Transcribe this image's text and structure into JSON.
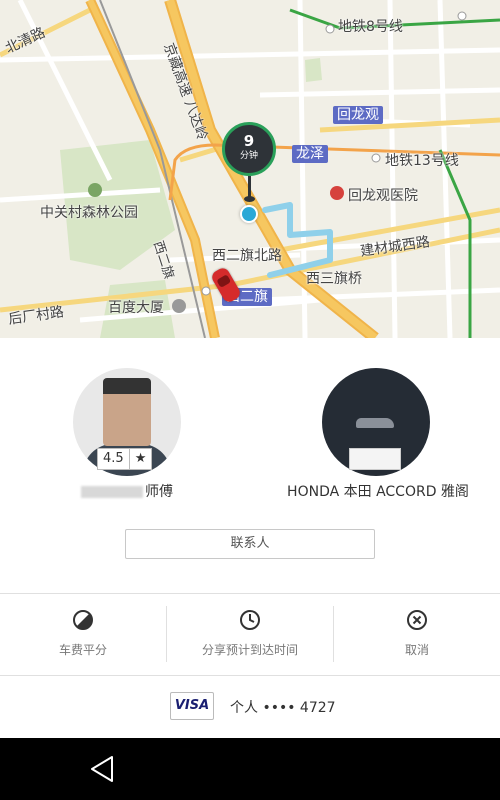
{
  "map": {
    "labels": {
      "beiqinglu": "北清路",
      "subway8": "地铁8号线",
      "expressway": "京藏高速 八达岭",
      "huilongguan_station": "回龙观",
      "longze_station": "龙泽",
      "subway13": "地铁13号线",
      "zhongguancun_park": "中关村森林公园",
      "huilongguan_hospital": "回龙观医院",
      "xierqi_road": "西二旗",
      "xierqi_north": "西二旗北路",
      "jiancai_west": "建材城西路",
      "xisanqi_bridge": "西三旗桥",
      "baidu_building": "百度大厦",
      "houchang_road": "后厂村路",
      "xierqi_station": "西二旗",
      "left_road": "地铁13号线"
    },
    "eta": {
      "minutes": "9",
      "unit": "分钟"
    }
  },
  "driver": {
    "rating": "4.5",
    "star": "★",
    "name_suffix": "师傅"
  },
  "vehicle": {
    "name": "HONDA 本田 ACCORD 雅阁"
  },
  "contact": {
    "label": "联系人"
  },
  "actions": {
    "split_fare": "车费平分",
    "share_eta": "分享预计到达时间",
    "cancel": "取消"
  },
  "payment": {
    "card_brand": "VISA",
    "text": "个人 •••• 4727"
  },
  "colors": {
    "accent_green": "#2aa05a",
    "route_blue": "#8fd0ea",
    "station_purple": "#5d6bc4",
    "car_red": "#d52b2b"
  }
}
